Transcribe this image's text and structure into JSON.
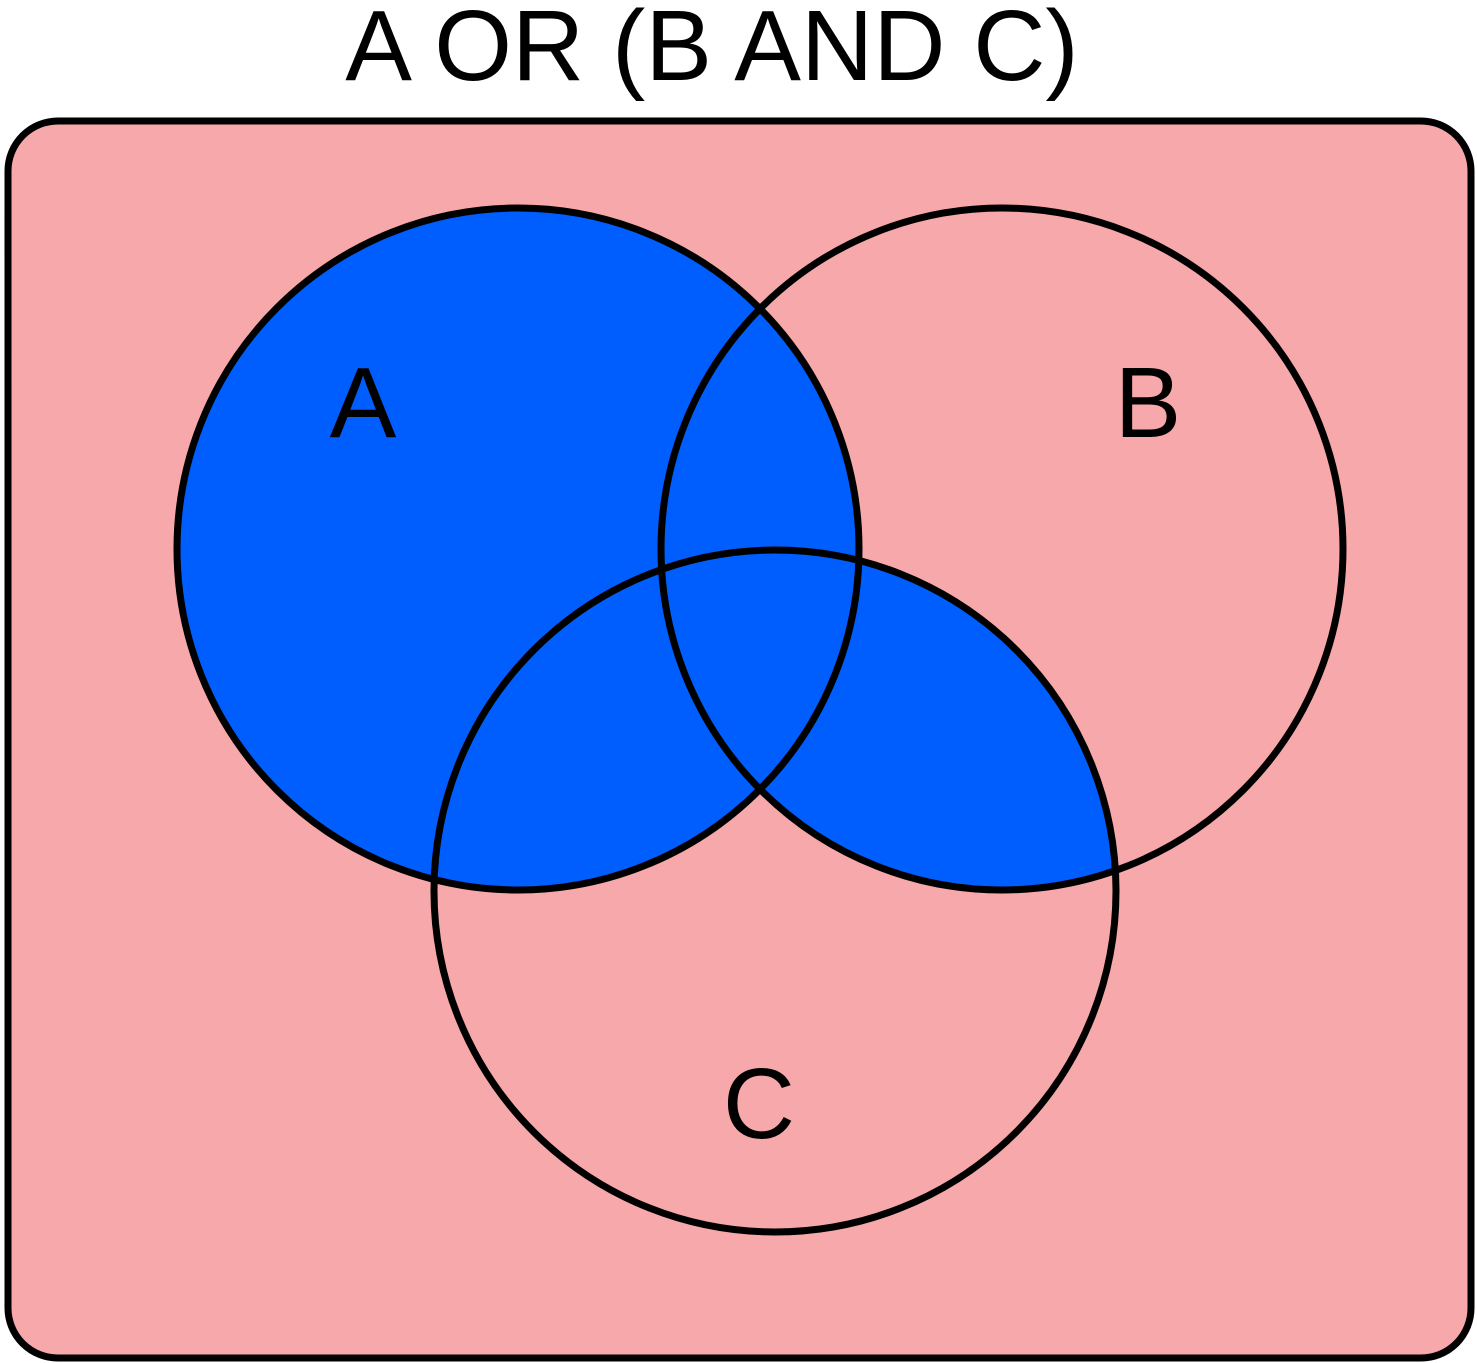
{
  "title": "A OR (B AND C)",
  "sets": {
    "a": {
      "label": "A"
    },
    "b": {
      "label": "B"
    },
    "c": {
      "label": "C"
    }
  },
  "colors": {
    "universe_fill": "#f7a8aa",
    "highlight_fill": "#005eff",
    "outline": "#000000",
    "text": "#000000"
  }
}
